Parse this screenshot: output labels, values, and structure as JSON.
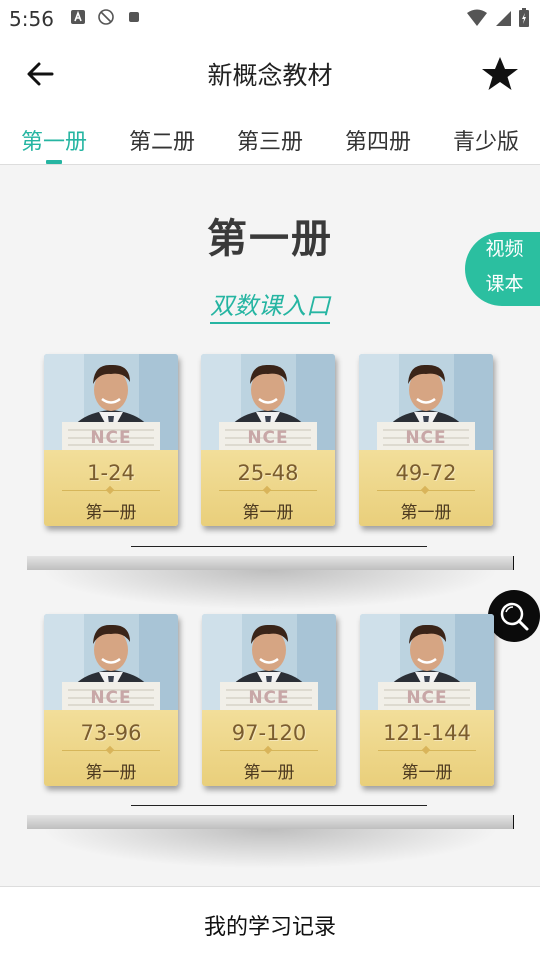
{
  "status": {
    "time": "5:56"
  },
  "header": {
    "title": "新概念教材"
  },
  "tabs": [
    {
      "label": "第一册",
      "active": true
    },
    {
      "label": "第二册"
    },
    {
      "label": "第三册"
    },
    {
      "label": "第四册"
    },
    {
      "label": "青少版"
    }
  ],
  "main": {
    "volume_title": "第一册",
    "entry_link": "双数课入口",
    "video_tab": {
      "line1": "视频",
      "line2": "课本"
    }
  },
  "books": [
    {
      "cover_text": "NCE",
      "range": "1-24",
      "volume": "第一册"
    },
    {
      "cover_text": "NCE",
      "range": "25-48",
      "volume": "第一册"
    },
    {
      "cover_text": "NCE",
      "range": "49-72",
      "volume": "第一册"
    },
    {
      "cover_text": "NCE",
      "range": "73-96",
      "volume": "第一册"
    },
    {
      "cover_text": "NCE",
      "range": "97-120",
      "volume": "第一册"
    },
    {
      "cover_text": "NCE",
      "range": "121-144",
      "volume": "第一册"
    }
  ],
  "bottom": {
    "label": "我的学习记录"
  },
  "colors": {
    "accent": "#26b5a2",
    "label_bg": "#efd98f"
  },
  "icons": [
    "back-arrow-icon",
    "star-icon",
    "search-icon"
  ]
}
